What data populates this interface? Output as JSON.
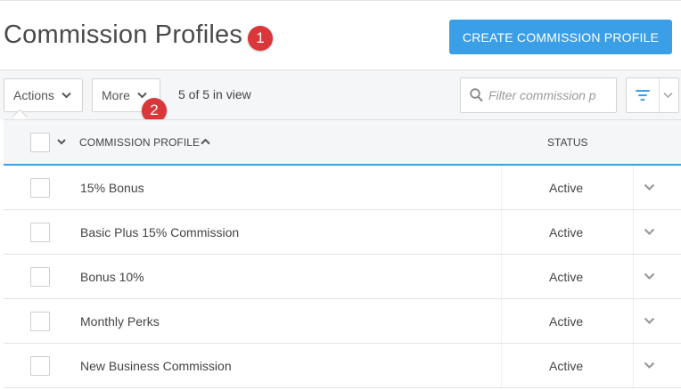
{
  "header": {
    "title": "Commission Profiles",
    "badge_1": "1",
    "create_button_label": "CREATE COMMISSION PROFILE"
  },
  "toolbar": {
    "actions_label": "Actions",
    "more_label": "More",
    "badge_2": "2",
    "in_view_text": "5 of 5 in view",
    "search_placeholder": "Filter commission p"
  },
  "table": {
    "columns": {
      "profile": "COMMISSION PROFILE",
      "status": "STATUS"
    },
    "rows": [
      {
        "name": "15% Bonus",
        "status": "Active"
      },
      {
        "name": "Basic Plus 15% Commission",
        "status": "Active"
      },
      {
        "name": "Bonus 10%",
        "status": "Active"
      },
      {
        "name": "Monthly Perks",
        "status": "Active"
      },
      {
        "name": "New Business Commission",
        "status": "Active"
      }
    ]
  },
  "icons": {
    "search": "search-icon",
    "filter": "filter-icon",
    "chevron": "chevron-down-icon",
    "sort": "sort-ascending-icon"
  },
  "colors": {
    "accent": "#3b9fe8",
    "badge": "#d9373a"
  }
}
